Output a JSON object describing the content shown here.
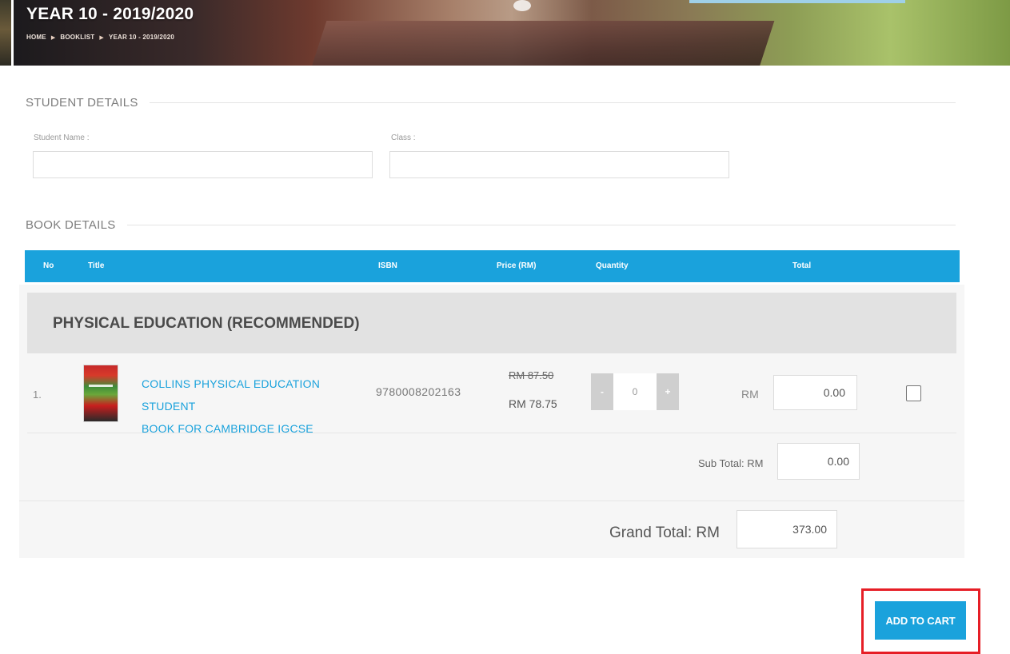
{
  "header": {
    "title": "YEAR 10 - 2019/2020",
    "breadcrumb": [
      "HOME",
      "BOOKLIST",
      "YEAR 10 - 2019/2020"
    ]
  },
  "student_details": {
    "heading": "STUDENT DETAILS",
    "name_label": "Student Name :",
    "name_value": "",
    "class_label": "Class :",
    "class_value": ""
  },
  "book_details": {
    "heading": "BOOK DETAILS",
    "columns": [
      "No",
      "Title",
      "ISBN",
      "Price (RM)",
      "Quantity",
      "Total"
    ],
    "category": "PHYSICAL EDUCATION (RECOMMENDED)",
    "items": [
      {
        "no": "1.",
        "title_line1": "COLLINS PHYSICAL EDUCATION STUDENT",
        "title_line2": "BOOK FOR CAMBRIDGE IGCSE",
        "isbn": "9780008202163",
        "price_original": "RM 87.50",
        "price_discounted": "RM 78.75",
        "qty_minus": "-",
        "quantity": "0",
        "qty_plus": "+",
        "currency": "RM",
        "total": "0.00",
        "selected": false
      }
    ],
    "subtotal_label": "Sub Total: RM",
    "subtotal": "0.00",
    "grand_total_label": "Grand Total: RM",
    "grand_total": "373.00"
  },
  "actions": {
    "add_to_cart": "ADD TO CART"
  },
  "colors": {
    "accent": "#1aa2dc",
    "highlight": "#e61e26",
    "category_bg": "#e2e2e2"
  }
}
